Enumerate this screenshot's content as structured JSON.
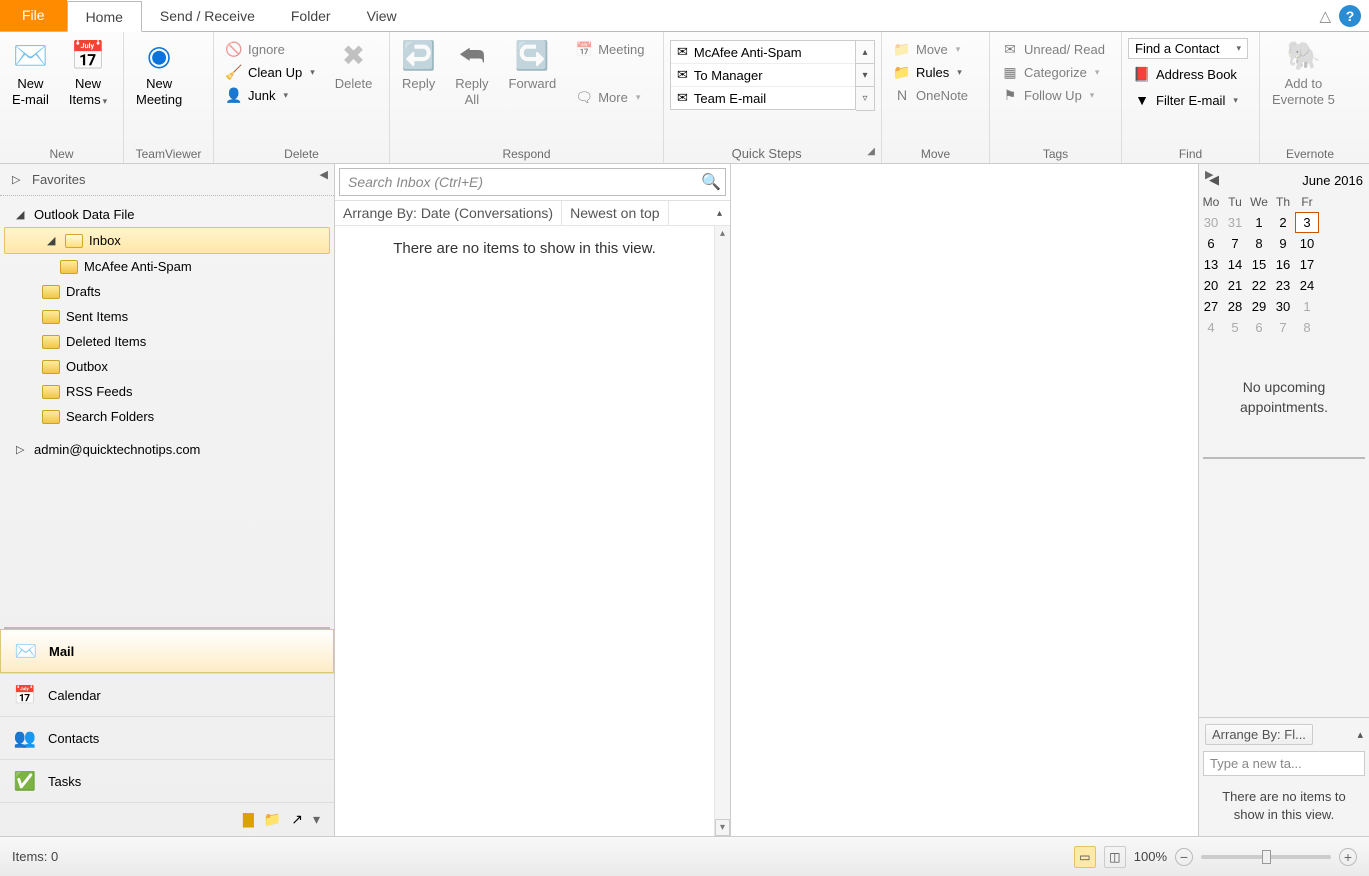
{
  "tabs": {
    "file": "File",
    "home": "Home",
    "send": "Send / Receive",
    "folder": "Folder",
    "view": "View"
  },
  "ribbon": {
    "new": {
      "label": "New",
      "email": "New\nE-mail",
      "items": "New\nItems"
    },
    "tv": {
      "label": "TeamViewer",
      "meeting": "New\nMeeting"
    },
    "del": {
      "label": "Delete",
      "ignore": "Ignore",
      "cleanup": "Clean Up",
      "junk": "Junk",
      "delete": "Delete"
    },
    "resp": {
      "label": "Respond",
      "reply": "Reply",
      "replyall": "Reply\nAll",
      "forward": "Forward",
      "meeting": "Meeting",
      "more": "More"
    },
    "qs": {
      "label": "Quick Steps",
      "a": "McAfee Anti-Spam",
      "b": "To Manager",
      "c": "Team E-mail"
    },
    "move": {
      "label": "Move",
      "move": "Move",
      "rules": "Rules",
      "onenote": "OneNote"
    },
    "tags": {
      "label": "Tags",
      "unread": "Unread/ Read",
      "cat": "Categorize",
      "follow": "Follow Up"
    },
    "find": {
      "label": "Find",
      "contact": "Find a Contact",
      "book": "Address Book",
      "filter": "Filter E-mail"
    },
    "ev": {
      "label": "Evernote",
      "add": "Add to\nEvernote 5"
    }
  },
  "nav": {
    "favorites": "Favorites",
    "datafile": "Outlook Data File",
    "inbox": "Inbox",
    "spam": "McAfee Anti-Spam",
    "drafts": "Drafts",
    "sent": "Sent Items",
    "deleted": "Deleted Items",
    "outbox": "Outbox",
    "rss": "RSS Feeds",
    "search": "Search Folders",
    "account": "admin@quicktechnotips.com",
    "mail": "Mail",
    "calendar": "Calendar",
    "contacts": "Contacts",
    "tasks": "Tasks"
  },
  "list": {
    "search_ph": "Search Inbox (Ctrl+E)",
    "arrange": "Arrange By: Date (Conversations)",
    "sort": "Newest on top",
    "empty": "There are no items to show in this view."
  },
  "todo": {
    "month": "June 2016",
    "days": [
      "Mo",
      "Tu",
      "We",
      "Th",
      "Fr"
    ],
    "rows": [
      [
        "30",
        "31",
        "1",
        "2",
        "3"
      ],
      [
        "6",
        "7",
        "8",
        "9",
        "10"
      ],
      [
        "13",
        "14",
        "15",
        "16",
        "17"
      ],
      [
        "20",
        "21",
        "22",
        "23",
        "24"
      ],
      [
        "27",
        "28",
        "29",
        "30",
        "1"
      ],
      [
        "4",
        "5",
        "6",
        "7",
        "8"
      ]
    ],
    "noappt": "No upcoming appointments.",
    "arrange": "Arrange By: Fl...",
    "newtask": "Type a new ta...",
    "empty": "There are no items to show in this view."
  },
  "status": {
    "items": "Items: 0",
    "zoom": "100%"
  }
}
